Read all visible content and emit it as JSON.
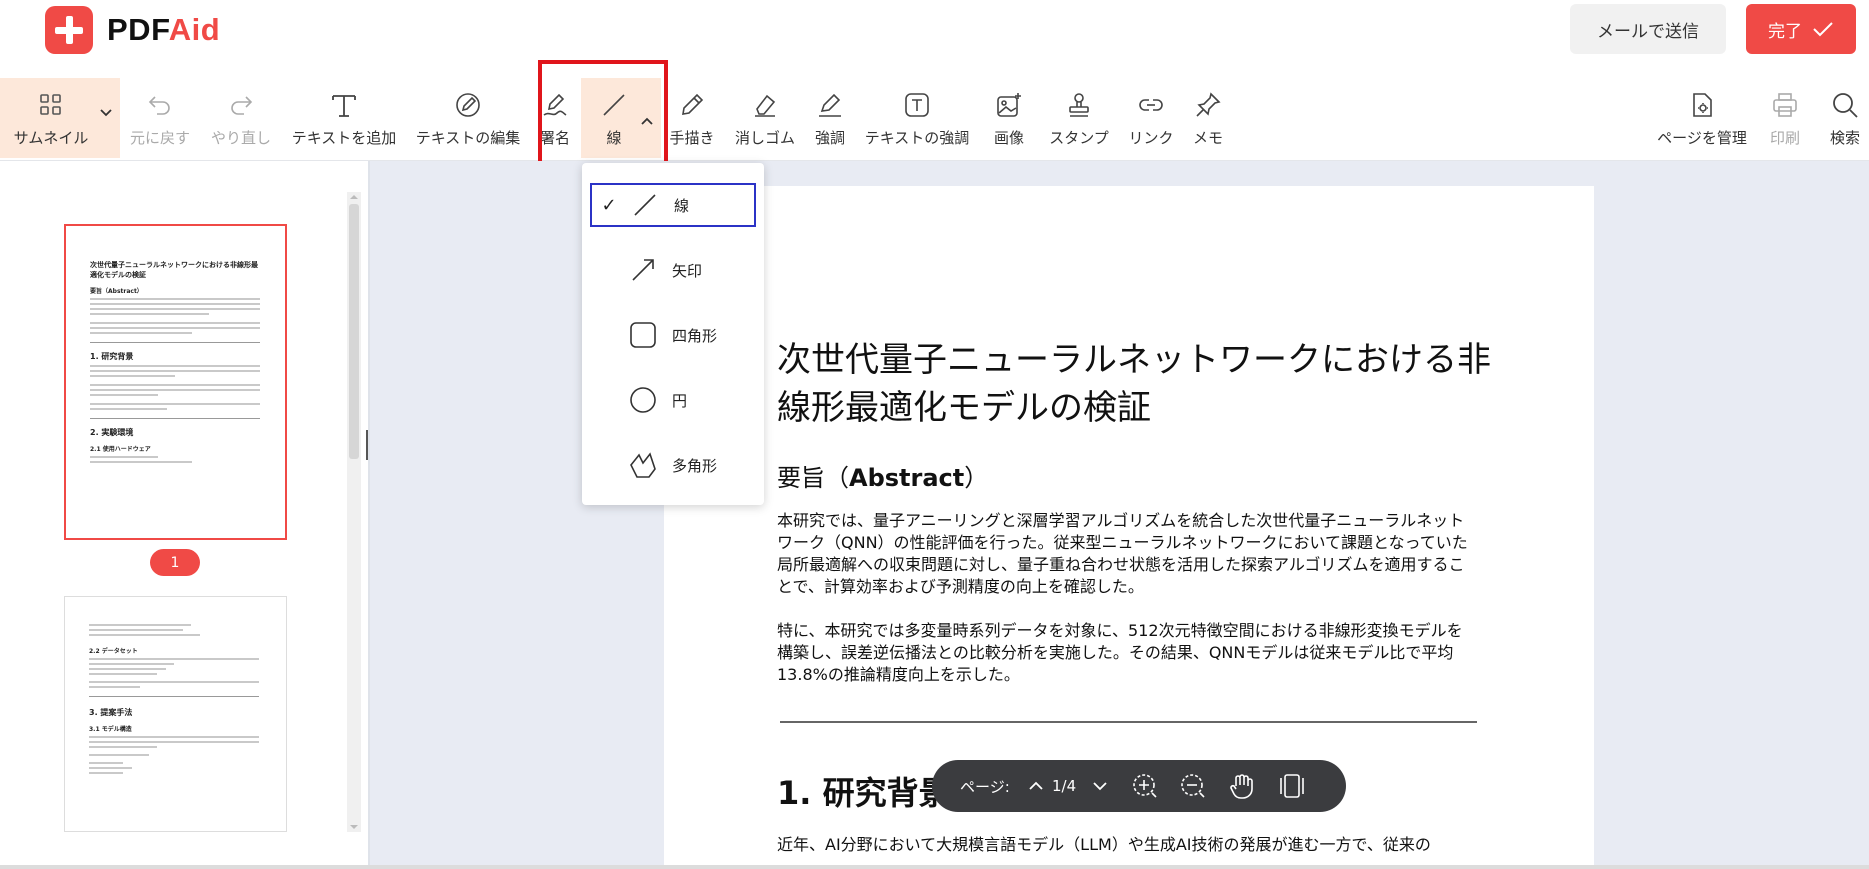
{
  "header": {
    "logo_prefix": "PDF",
    "logo_suffix": "Aid",
    "mail_button": "メールで送信",
    "done_button": "完了"
  },
  "toolbar": {
    "thumbnail": "サムネイル",
    "undo": "元に戻す",
    "redo": "やり直し",
    "add_text": "テキストを追加",
    "edit_text": "テキストの編集",
    "sign": "署名",
    "line": "線",
    "draw": "手描き",
    "eraser": "消しゴム",
    "highlight": "強調",
    "text_highlight": "テキストの強調",
    "image": "画像",
    "stamp": "スタンプ",
    "link": "リンク",
    "memo": "メモ",
    "manage_pages": "ページを管理",
    "print": "印刷",
    "search": "検索"
  },
  "shape_menu": {
    "items": [
      {
        "label": "線",
        "icon": "line-icon",
        "selected": true
      },
      {
        "label": "矢印",
        "icon": "arrow-icon",
        "selected": false
      },
      {
        "label": "四角形",
        "icon": "rectangle-icon",
        "selected": false
      },
      {
        "label": "円",
        "icon": "circle-icon",
        "selected": false
      },
      {
        "label": "多角形",
        "icon": "polygon-icon",
        "selected": false
      }
    ]
  },
  "sidebar": {
    "current_page_badge": "1",
    "thumb1": {
      "title": "次世代量子ニューラルネットワークにおける非線形最適化モデルの検証",
      "h_abstract": "要旨（Abstract）",
      "h1": "1. 研究背景",
      "h2": "2. 実験環境",
      "h21": "2.1 使用ハードウェア"
    },
    "thumb2": {
      "h22": "2.2 データセット",
      "h3": "3. 提案手法",
      "h31": "3.1 モデル構造"
    }
  },
  "document": {
    "title": "次世代量子ニューラルネットワークにおける非線形最適化モデルの検証",
    "abstract_heading_jp": "要旨（",
    "abstract_heading_en": "Abstract",
    "abstract_heading_end": "）",
    "para1": "本研究では、量子アニーリングと深層学習アルゴリズムを統合した次世代量子ニューラルネットワーク（QNN）の性能評価を行った。従来型ニューラルネットワークにおいて課題となっていた局所最適解への収束問題に対し、量子重ね合わせ状態を活用した探索アルゴリズムを適用することで、計算効率および予測精度の向上を確認した。",
    "para2": "特に、本研究では多変量時系列データを対象に、512次元特徴空間における非線形変換モデルを構築し、誤差逆伝播法との比較分析を実施した。その結果、QNNモデルは従来モデル比で平均13.8%の推論精度向上を示した。",
    "section1": "1. 研究背景",
    "para3": "近年、AI分野において大規模言語モデル（LLM）や生成AI技術の発展が進む一方で、従来の"
  },
  "pagebar": {
    "label": "ページ:",
    "current": "1",
    "total": "4",
    "separator": "/"
  },
  "colors": {
    "brand": "#f04a46",
    "selection_border": "#2b33c6",
    "highlight_box": "#e0151b",
    "tool_active_bg": "#fde8da"
  }
}
